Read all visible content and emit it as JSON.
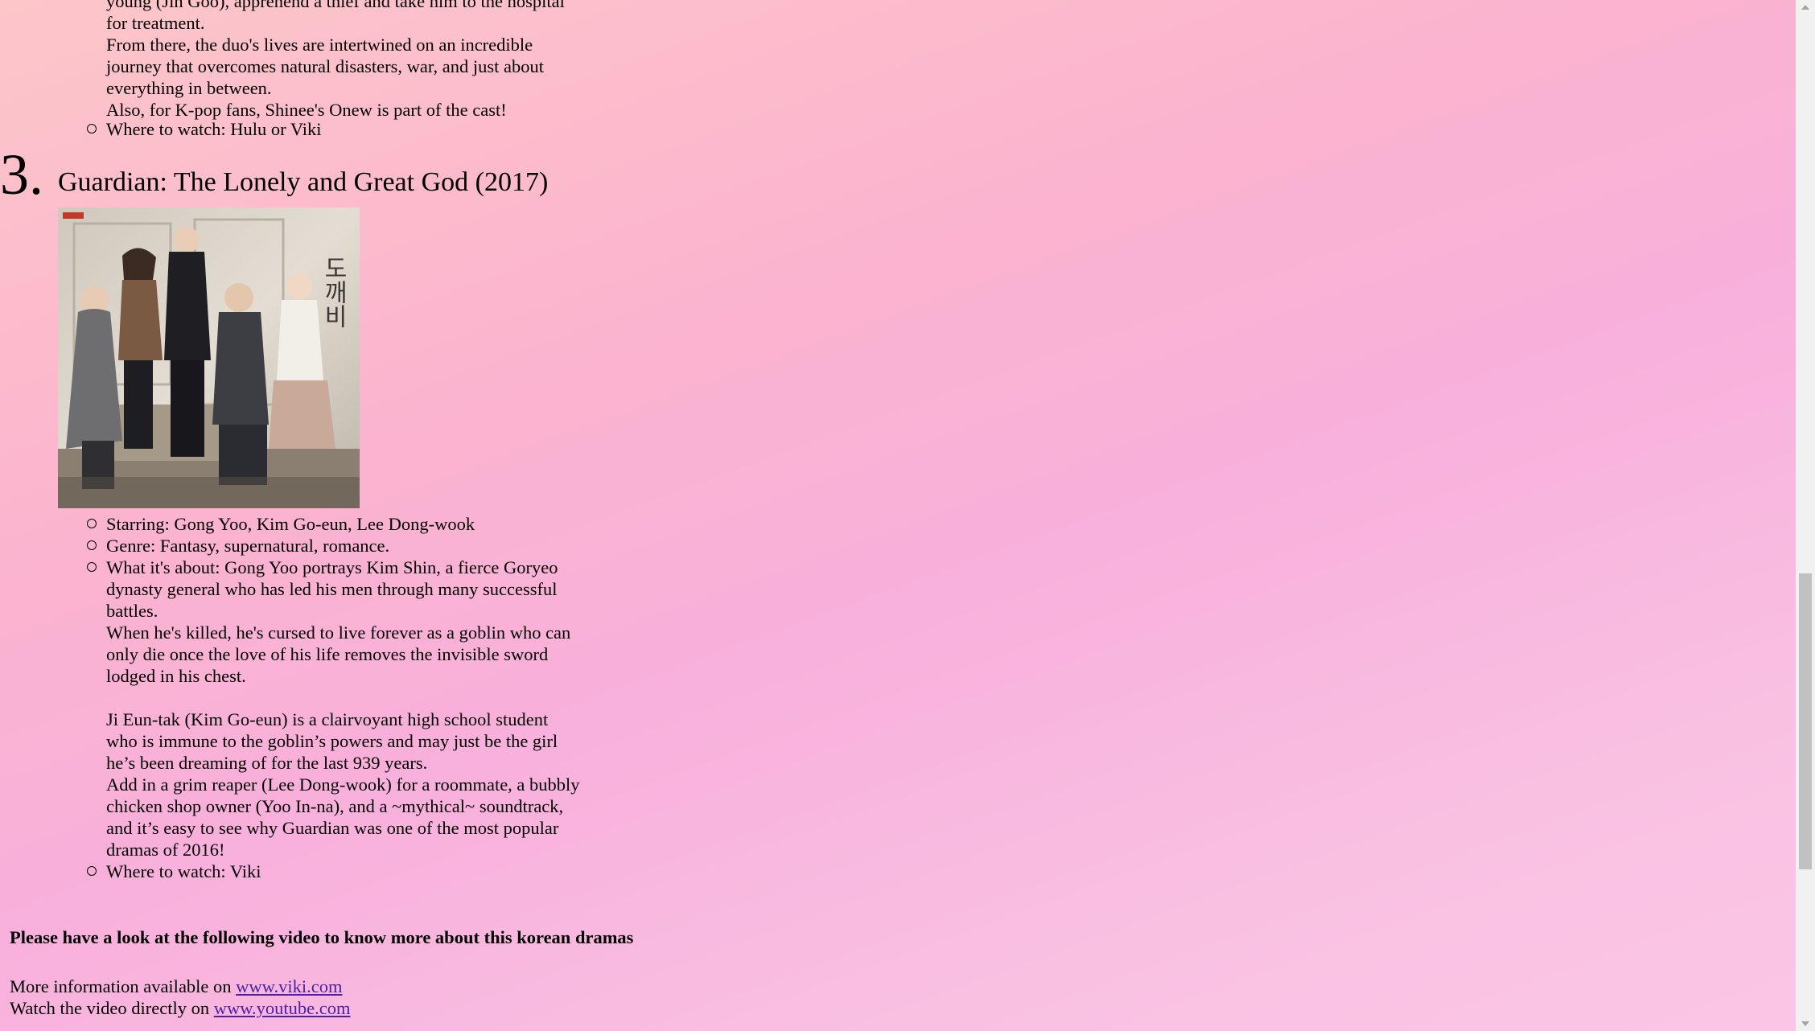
{
  "prev_item": {
    "partial_line_1": "young (Jin Goo), apprehend a thief and take him to the hospital",
    "partial_line_2": "for treatment.",
    "para_1_lines": [
      "From there, the duo's lives are intertwined on an incredible",
      "journey that overcomes natural disasters, war, and just about",
      "everything in between."
    ],
    "para_2": "Also, for K-pop fans, Shinee's Onew is part of the cast!",
    "where_to_watch": "Where to watch: Hulu or Viki"
  },
  "item3": {
    "number": "3.",
    "title": "Guardian: The Lonely and Great God (2017)",
    "starring": "Starring: Gong Yoo, Kim Go-eun, Lee Dong-wook",
    "genre": "Genre: Fantasy, supernatural, romance.",
    "about_lines": [
      "What it's about: Gong Yoo portrays Kim Shin, a fierce Goryeo",
      "dynasty general who has led his men through many successful",
      "battles.",
      "When he's killed, he's cursed to live forever as a goblin who can",
      "only die once the love of his life removes the invisible sword",
      "lodged in his chest.",
      "",
      "Ji Eun-tak (Kim Go-eun) is a clairvoyant high school student",
      "who is immune to the goblin’s powers and may just be the girl",
      "he’s been dreaming of for the last 939 years.",
      "Add in a grim reaper (Lee Dong-wook) for a roommate, a bubbly",
      "chicken shop owner (Yoo In-na), and a ~mythical~ soundtrack,",
      "and it’s easy to see why Guardian was one of the most popular",
      "dramas of 2016!"
    ],
    "where_to_watch": "Where to watch: Viki",
    "poster_text": "도깨비"
  },
  "footer": {
    "heading": "Please have a look at the following video to know more about this korean dramas",
    "more_info_prefix": "More information available on ",
    "more_info_link": "www.viki.com",
    "watch_prefix": "Watch the video directly on ",
    "watch_link": "www.youtube.com"
  },
  "colors": {
    "link": "#4a1fa3",
    "bg_top": "#fdc6c9",
    "bg_mid": "#f8b0dc"
  }
}
